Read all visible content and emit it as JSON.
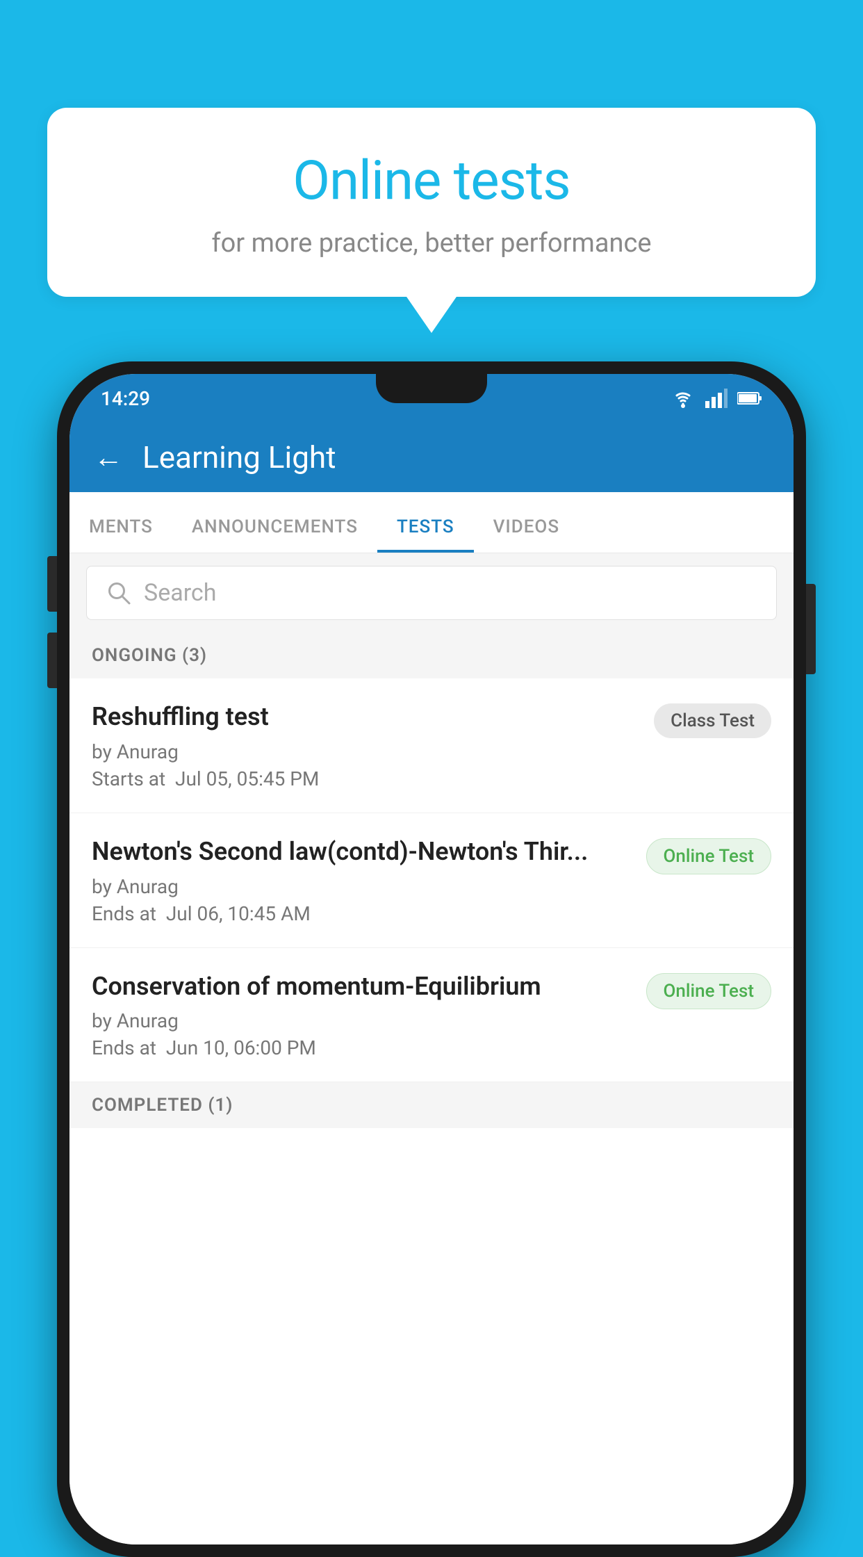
{
  "background_color": "#1BB8E8",
  "speech_bubble": {
    "title": "Online tests",
    "subtitle": "for more practice, better performance"
  },
  "phone": {
    "status_bar": {
      "time": "14:29",
      "icons": [
        "wifi",
        "signal",
        "battery"
      ]
    },
    "app_header": {
      "back_label": "←",
      "title": "Learning Light"
    },
    "tabs": [
      {
        "label": "MENTS",
        "active": false
      },
      {
        "label": "ANNOUNCEMENTS",
        "active": false
      },
      {
        "label": "TESTS",
        "active": true
      },
      {
        "label": "VIDEOS",
        "active": false
      }
    ],
    "search": {
      "placeholder": "Search"
    },
    "ongoing_section": {
      "header": "ONGOING (3)",
      "tests": [
        {
          "name": "Reshuffling test",
          "by": "by Anurag",
          "date_label": "Starts at",
          "date": "Jul 05, 05:45 PM",
          "badge": "Class Test",
          "badge_type": "class"
        },
        {
          "name": "Newton's Second law(contd)-Newton's Thir...",
          "by": "by Anurag",
          "date_label": "Ends at",
          "date": "Jul 06, 10:45 AM",
          "badge": "Online Test",
          "badge_type": "online"
        },
        {
          "name": "Conservation of momentum-Equilibrium",
          "by": "by Anurag",
          "date_label": "Ends at",
          "date": "Jun 10, 06:00 PM",
          "badge": "Online Test",
          "badge_type": "online"
        }
      ]
    },
    "completed_section": {
      "header": "COMPLETED (1)"
    }
  }
}
